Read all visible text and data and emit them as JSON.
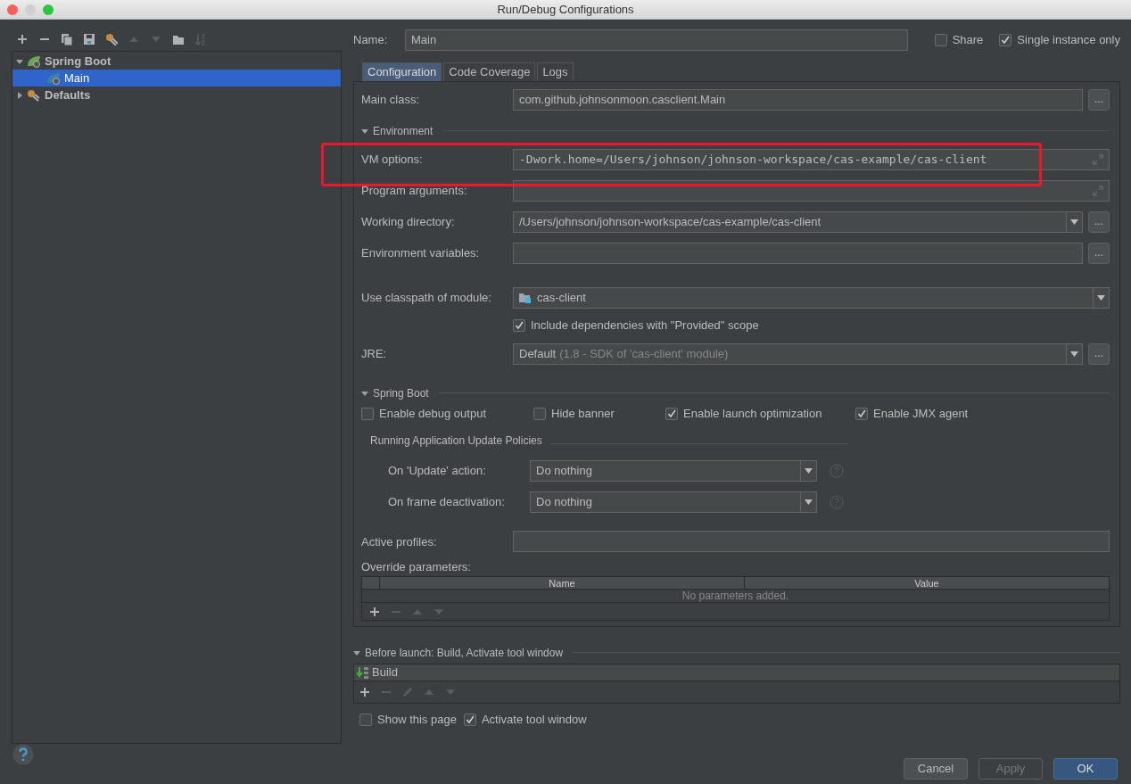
{
  "window": {
    "title": "Run/Debug Configurations"
  },
  "toolbar": [
    {
      "kind": "add",
      "disabled": false
    },
    {
      "kind": "remove",
      "disabled": false
    },
    {
      "kind": "copy",
      "disabled": false
    },
    {
      "kind": "save",
      "disabled": false
    },
    {
      "kind": "edit-defaults",
      "disabled": false
    },
    {
      "kind": "up",
      "disabled": true
    },
    {
      "kind": "down",
      "disabled": true
    },
    {
      "kind": "folder",
      "disabled": false
    },
    {
      "kind": "sort",
      "disabled": true
    }
  ],
  "tree": [
    {
      "label": "Spring Boot",
      "kind": "spring",
      "expanded": true,
      "selected": false,
      "children": [
        {
          "label": "Main",
          "kind": "spring-run",
          "selected": true
        }
      ]
    },
    {
      "label": "Defaults",
      "kind": "defaults",
      "expanded": false,
      "selected": false
    }
  ],
  "name_field": {
    "label": "Name:",
    "value": "Main"
  },
  "header_options": [
    {
      "label": "Share",
      "checked": false
    },
    {
      "label": "Single instance only",
      "checked": true
    }
  ],
  "tabs": [
    {
      "label": "Configuration",
      "selected": true
    },
    {
      "label": "Code Coverage",
      "selected": false
    },
    {
      "label": "Logs",
      "selected": false
    }
  ],
  "main_class": {
    "label": "Main class:",
    "value": "com.github.johnsonmoon.casclient.Main",
    "browse": "..."
  },
  "environment": {
    "title": "Environment",
    "expanded": true,
    "rows": [
      {
        "kind": "expand",
        "label": "VM options:",
        "value": "-Dwork.home=/Users/johnson/johnson-workspace/cas-example/cas-client"
      },
      {
        "kind": "expand",
        "label": "Program arguments:"
      },
      {
        "kind": "combo-browse",
        "label": "Working directory:",
        "value": "/Users/johnson/johnson-workspace/cas-example/cas-client",
        "browse": "..."
      },
      {
        "kind": "browse",
        "label": "Environment variables:",
        "browse": "..."
      },
      {
        "kind": "module",
        "label": "Use classpath of module:",
        "value": "cas-client"
      },
      {
        "kind": "checkbox",
        "label": "Include dependencies with \"Provided\" scope",
        "checked": true
      },
      {
        "kind": "jre",
        "label": "JRE:",
        "value": "Default",
        "hint": "(1.8 - SDK of 'cas-client' module)",
        "browse": "..."
      }
    ]
  },
  "spring_boot": {
    "title": "Spring Boot",
    "expanded": true,
    "options": [
      {
        "label": "Enable debug output",
        "checked": false
      },
      {
        "label": "Hide banner",
        "checked": false
      },
      {
        "label": "Enable launch optimization",
        "checked": true
      },
      {
        "label": "Enable JMX agent",
        "checked": true
      }
    ],
    "policies": {
      "title": "Running Application Update Policies",
      "rows": [
        {
          "label": "On 'Update' action:",
          "value": "Do nothing"
        },
        {
          "label": "On frame deactivation:",
          "value": "Do nothing"
        }
      ]
    }
  },
  "active_profiles": {
    "label": "Active profiles:"
  },
  "override_parameters": {
    "label": "Override parameters:",
    "columns": [
      "Name",
      "Value"
    ],
    "empty_text": "No parameters added.",
    "actions": [
      {
        "kind": "add",
        "disabled": false
      },
      {
        "kind": "remove",
        "disabled": true
      },
      {
        "kind": "up",
        "disabled": true
      },
      {
        "kind": "down",
        "disabled": true
      }
    ]
  },
  "before_launch": {
    "title": "Before launch: Build, Activate tool window",
    "expanded": true,
    "tasks": [
      {
        "label": "Build"
      }
    ],
    "actions": [
      {
        "kind": "add",
        "disabled": false
      },
      {
        "kind": "remove",
        "disabled": true
      },
      {
        "kind": "edit",
        "disabled": true
      },
      {
        "kind": "up",
        "disabled": true
      },
      {
        "kind": "down",
        "disabled": true
      }
    ],
    "options": [
      {
        "label": "Show this page",
        "checked": false
      },
      {
        "label": "Activate tool window",
        "checked": true
      }
    ]
  },
  "buttons": [
    {
      "label": "Cancel",
      "kind": "default",
      "disabled": false
    },
    {
      "label": "Apply",
      "kind": "default",
      "disabled": true
    },
    {
      "label": "OK",
      "kind": "primary",
      "disabled": false
    }
  ]
}
